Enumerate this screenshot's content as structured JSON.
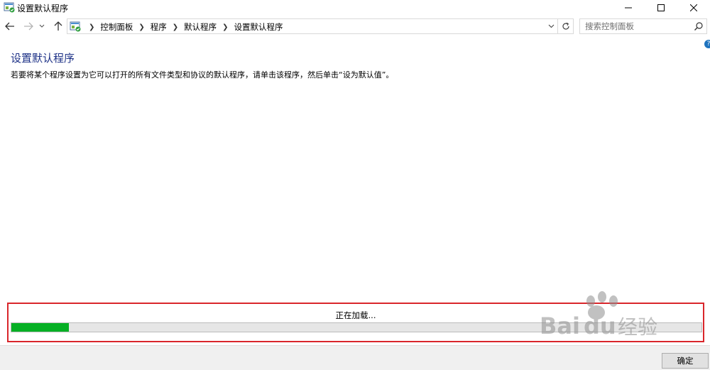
{
  "window": {
    "title": "设置默认程序",
    "icon": "control-panel-icon"
  },
  "nav": {
    "breadcrumbs": [
      "控制面板",
      "程序",
      "默认程序",
      "设置默认程序"
    ],
    "search_placeholder": "搜索控制面板"
  },
  "main": {
    "heading": "设置默认程序",
    "description": "若要将某个程序设置为它可以打开的所有文件类型和协议的默认程序，请单击该程序，然后单击“设为默认值”。"
  },
  "loading": {
    "text": "正在加载...",
    "progress_percent": 8.3,
    "bar_color": "#06b025",
    "highlight_color": "#d9262b"
  },
  "footer": {
    "ok_label": "确定"
  },
  "colors": {
    "heading": "#1e3287"
  }
}
